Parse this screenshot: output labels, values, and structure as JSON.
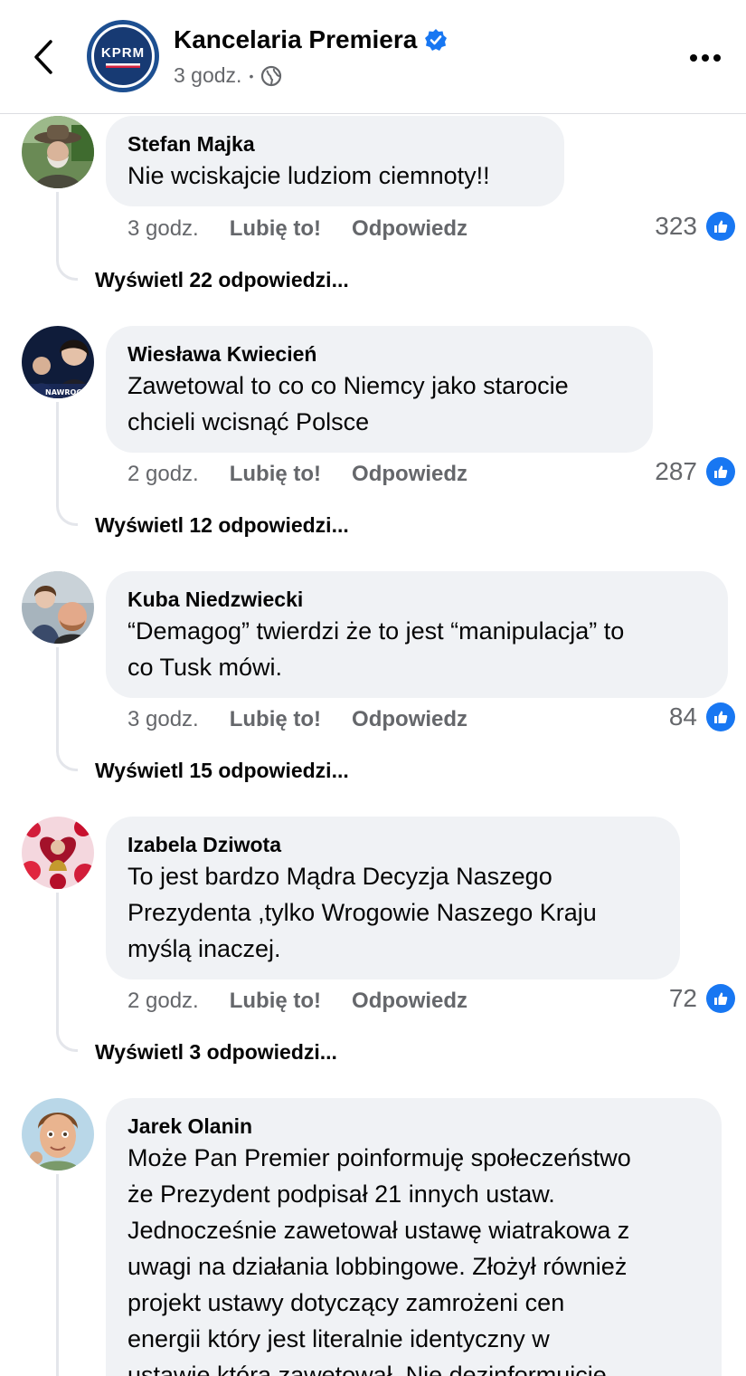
{
  "header": {
    "page_name": "Kancelaria Premiera",
    "avatar_text": "KPRM",
    "time": "3 godz.",
    "separator": "•",
    "back_icon": "chevron-left-icon",
    "verified_icon": "verified-badge-icon",
    "audience_icon": "globe-icon",
    "more_icon": "more-horizontal-icon"
  },
  "colors": {
    "like_blue": "#1877f2",
    "bubble": "#f0f2f5",
    "secondary_text": "#65676b"
  },
  "comments": [
    {
      "author": "Stefan Majka",
      "text": "Nie wciskajcie ludziom ciemnoty!!",
      "time": "3 godz.",
      "like_label": "Lubię to!",
      "reply_label": "Odpowiedz",
      "reaction_count": "323",
      "view_replies": "Wyświetl 22 odpowiedzi..."
    },
    {
      "author": "Wiesława Kwiecień",
      "text": "Zawetowal to co co Niemcy jako starocie\nchcieli wcisnąć Polsce",
      "time": "2 godz.",
      "like_label": "Lubię to!",
      "reply_label": "Odpowiedz",
      "reaction_count": "287",
      "view_replies": "Wyświetl 12 odpowiedzi...",
      "avatar_caption": "NAWROCKI"
    },
    {
      "author": "Kuba Niedzwiecki",
      "text": "“Demagog” twierdzi że to jest “manipulacja” to\nco Tusk mówi.",
      "time": "3 godz.",
      "like_label": "Lubię to!",
      "reply_label": "Odpowiedz",
      "reaction_count": "84",
      "view_replies": "Wyświetl 15 odpowiedzi..."
    },
    {
      "author": "Izabela Dziwota",
      "text": "To jest bardzo Mądra Decyzja Naszego\nPrezydenta ,tylko Wrogowie Naszego Kraju\nmyślą inaczej.",
      "time": "2 godz.",
      "like_label": "Lubię to!",
      "reply_label": "Odpowiedz",
      "reaction_count": "72",
      "view_replies": "Wyświetl 3 odpowiedzi..."
    },
    {
      "author": "Jarek Olanin",
      "text": "Może Pan Premier poinformuję społeczeństwo\nże Prezydent podpisał 21 innych ustaw.\nJednocześnie zawetował ustawę wiatrakowa z\nuwagi na działania lobbingowe. Złożył również\nprojekt ustawy dotyczący zamrożeni cen\nenergii który jest literalnie identyczny w\nustawie która zawetował. Nie dezinformujcie"
    }
  ]
}
